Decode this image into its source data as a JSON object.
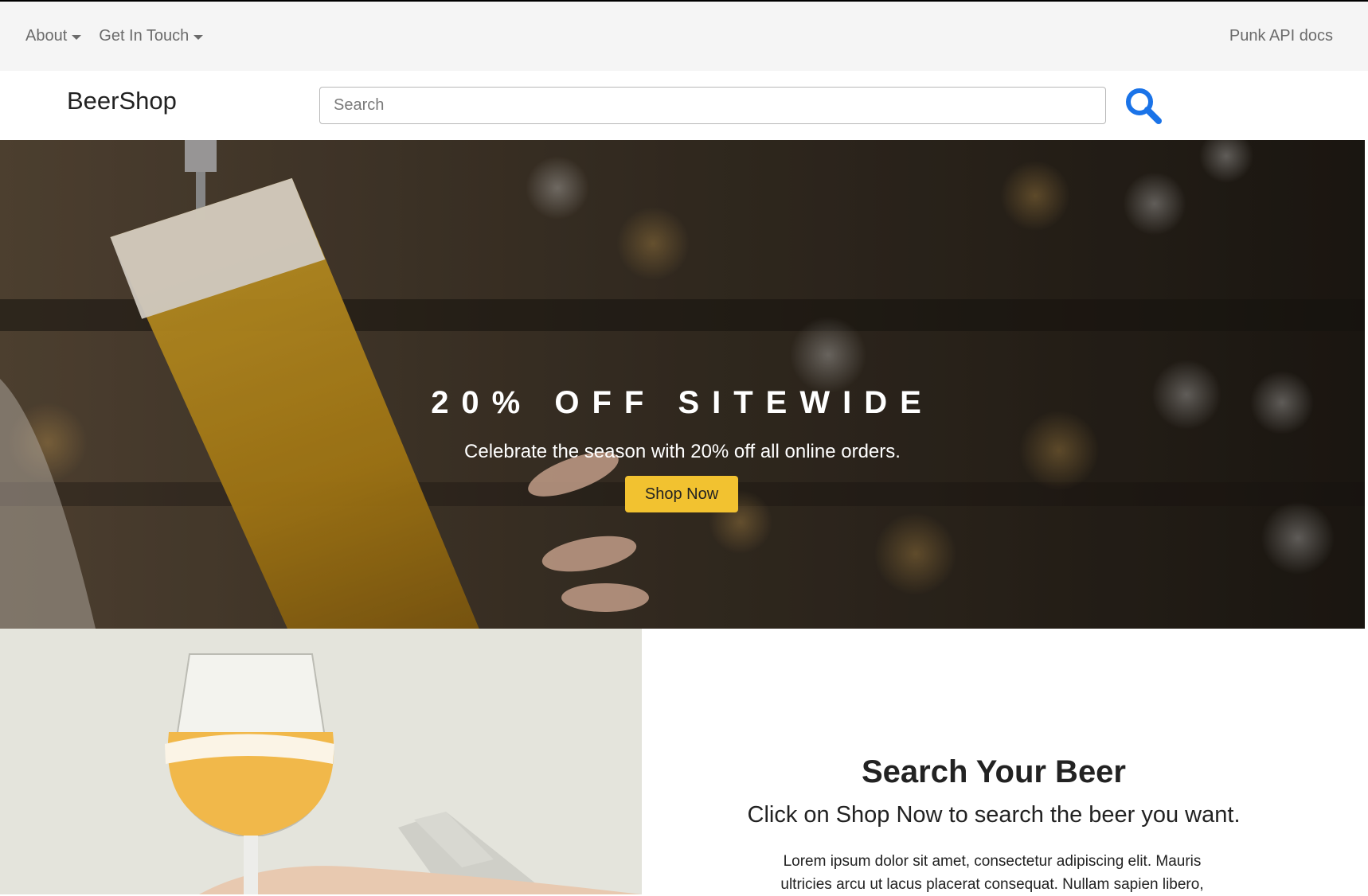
{
  "topnav": {
    "items": [
      {
        "label": "About"
      },
      {
        "label": "Get In Touch"
      }
    ],
    "right_link": "Punk API docs"
  },
  "brandbar": {
    "brand": "BeerShop",
    "search_placeholder": "Search",
    "search_value": ""
  },
  "hero": {
    "title": "20% OFF SITEWIDE",
    "subtitle": "Celebrate the season with 20% off all online orders.",
    "button_label": "Shop Now"
  },
  "feature": {
    "title": "Search Your Beer",
    "subtitle": "Click on Shop Now to search the beer you want.",
    "body": "Lorem ipsum dolor sit amet, consectetur adipiscing elit. Mauris ultricies arcu ut lacus placerat consequat. Nullam sapien libero,"
  },
  "colors": {
    "accent_button": "#f2c230",
    "search_icon": "#1a73e8",
    "topnav_bg": "#f5f5f5"
  },
  "icons": {
    "search": "search-icon",
    "caret": "caret-down-icon"
  }
}
